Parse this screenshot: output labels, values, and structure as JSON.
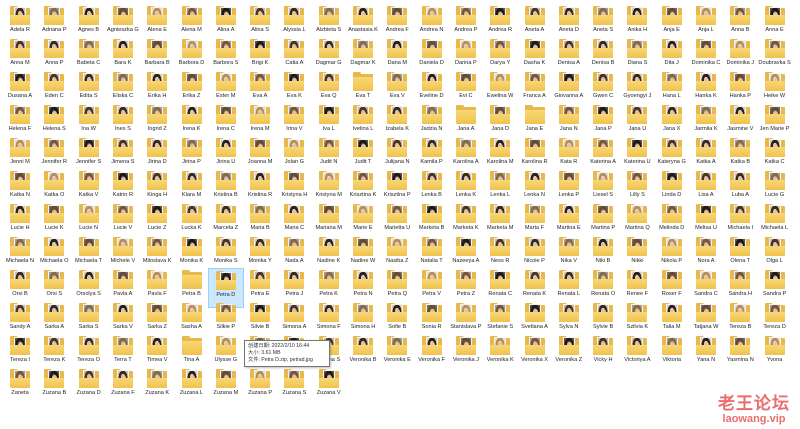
{
  "folders": [
    "Adela R",
    "Adriana P",
    "Agnes B",
    "Agnieszka G",
    "Alena E",
    "Alena M",
    "Alina A",
    "Alina S",
    "Alyssia L",
    "Alzbieta S",
    "Anastasia K",
    "Andrea F",
    "Andrea N",
    "Andrea P",
    "Andrea R",
    "Aneta A",
    "Aneta D",
    "Aneta S",
    "Anika H",
    "Anja E",
    "Anja L",
    "Anna B",
    "Anna E",
    "Anna M",
    "Anna P",
    "Babeta C",
    "Bara K",
    "Barbara B",
    "Barbora D",
    "Barbora S",
    "Brigi K",
    "Catia A",
    "Dagmar G",
    "Dagmar K",
    "Dana M",
    "Daniela D",
    "Darina P",
    "Darya Y",
    "Dasha K",
    "Denisa A",
    "Denisa B",
    "Diana S",
    "Dita J",
    "Dominika C",
    "Dominika J",
    "Doubravka S",
    "Dusana A",
    "Eden C",
    "Edita S",
    "Eliska C",
    "Erika H",
    "Erika Z",
    "Ester M",
    "Eva A",
    "Eva K",
    "Eva Q",
    "Eva T",
    "Eva V",
    "Eveline D",
    "Evi C",
    "Ewelina W",
    "Franca A",
    "Giovanna A",
    "Gwen C",
    "Gyoengyi J",
    "Hana L",
    "Hanka K",
    "Hanka P",
    "Heike W",
    "Helena F",
    "Helena S",
    "Ina W",
    "Ines S",
    "Ingrid Z",
    "Irena K",
    "Irena C",
    "Irena M",
    "Irina V",
    "Iva L",
    "Ivelina L",
    "Izabela K",
    "Jadzia N",
    "Jana A",
    "Jana D",
    "Jana E",
    "Jana N",
    "Jana P",
    "Jana U",
    "Jana X",
    "Jarmila K",
    "Jasmine V",
    "Jen Marie P",
    "Jenni M",
    "Jennifer R",
    "Jennifer S",
    "Jimena S",
    "Jirina D",
    "Jirina P",
    "Jirina U",
    "Joanna M",
    "Jolan G",
    "Judit N",
    "Judit T",
    "Julijana N",
    "Kamila P",
    "Karolina A",
    "Karolina M",
    "Karolina R",
    "Kata R",
    "Katerina A",
    "Katerina U",
    "Kateryna G",
    "Katka A",
    "Katka B",
    "Katka C",
    "Katka N",
    "Katka O",
    "Katka V",
    "Katrin R",
    "Kinga H",
    "Klara M",
    "Kristina B",
    "Kristina R",
    "Kristyna H",
    "Kristyna M",
    "Krisztina K",
    "Krisztina P",
    "Lenka B",
    "Lenka K",
    "Lenka L",
    "Lenka N",
    "Lenka P",
    "Liesel S",
    "Lilly S",
    "Linda D",
    "Lisa A",
    "Luba A",
    "Lucie G",
    "Lucie H",
    "Lucie K",
    "Lucie N",
    "Lucie V",
    "Lucie Z",
    "Lucka K",
    "Marcela Z",
    "Maria B",
    "Maria C",
    "Mariana M",
    "Marie E",
    "Marietta U",
    "Marketa B",
    "Marketa K",
    "Marketa M",
    "Marta F",
    "Martina E",
    "Martina P",
    "Martina Q",
    "Melinda D",
    "Melisa U",
    "Michaela I",
    "Michaela L",
    "Michaela N",
    "Michaela O",
    "Michaela T",
    "Michele V",
    "Miloslava K",
    "Monika K",
    "Monika S",
    "Monika Y",
    "Nada A",
    "Nadine K",
    "Nadine W",
    "Nasiba Z",
    "Natalia T",
    "Nazeeya A",
    "Ness R",
    "Nicole P",
    "Nika V",
    "Niki B",
    "Nikki",
    "Nikola P",
    "Nora A",
    "Olena T",
    "Olga L",
    "Orsi B",
    "Orsi S",
    "Orsolya S",
    "Pavla A",
    "Pavla F",
    "Petra B",
    "Petra D",
    "Petra E",
    "Petra J",
    "Petra K",
    "Petra N",
    "Petra Q",
    "Petra V",
    "Petra Z",
    "Renata C",
    "Renata K",
    "Renata L",
    "Renata O",
    "Renee F",
    "Roser F",
    "Sandra C",
    "Sandra H",
    "Sandra P",
    "Sandy A",
    "Sarka A",
    "Sarka S",
    "Sarka V",
    "Sarka Z",
    "Sasha A",
    "Silkie P",
    "Silvie B",
    "Simona A",
    "Simona F",
    "Simona H",
    "Sofie B",
    "Sonia R",
    "Stanislava P",
    "Stefanie S",
    "Svetlana A",
    "Sylva N",
    "Sylvie B",
    "Szilvia K",
    "Talia M",
    "Tatjana W",
    "Tereza B",
    "Tereza D",
    "Tereza I",
    "Tereza K",
    "Tereza O",
    "Terra T",
    "Timea V",
    "Tina A",
    "Ulysse G",
    "Ursula S",
    "Valentina T",
    "Verena S",
    "Veronika B",
    "Veronika E",
    "Veronika F",
    "Veronika J",
    "Veronika K",
    "Veronika X",
    "Veronika Z",
    "Vicky H",
    "Victoriya A",
    "Viktoria",
    "Yana N",
    "Yasmina N",
    "Yvona",
    "Zaneta",
    "Zuzana B",
    "Zuzana D",
    "Zuzana F",
    "Zuzana K",
    "Zuzana L",
    "Zuzana M",
    "Zuzana P",
    "Zuzana S",
    "Zuzana V"
  ],
  "plain_folders": [
    "Eva T",
    "Jana A",
    "Jana E",
    "Petra B",
    "Tina A"
  ],
  "selected": "Petra D",
  "tooltip": {
    "line1": "创建日期: 2022/2/10 16:44",
    "line2": "大小: 3.61 MB",
    "line3": "文件: Petra D.zip, petrad.jpg"
  },
  "watermark": {
    "title": "老王论坛",
    "url": "laowang.vip"
  },
  "colors": {
    "folder": "#f0c24e",
    "selection": "#cce8ff",
    "watermark": "#e34b4b"
  }
}
